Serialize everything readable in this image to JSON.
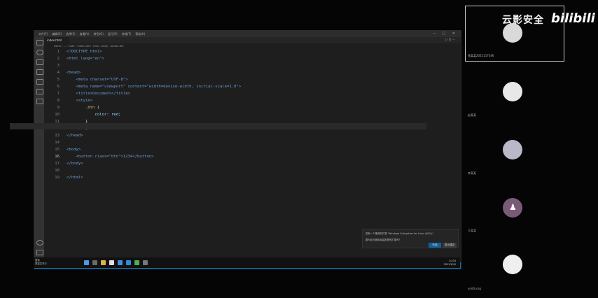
{
  "editor": {
    "menu": [
      "文件(F)",
      "编辑(E)",
      "选择(S)",
      "查看(V)",
      "转到(G)",
      "运行(R)",
      "终端(T)",
      "帮助(H)"
    ],
    "tab_label": "index.html",
    "breadcrumb": "Users › ... › code › index.html › html › body › button.btn",
    "lines": [
      {
        "n": "1",
        "t": "<!DOCTYPE html>"
      },
      {
        "n": "2",
        "t": "<html lang=\"en\">"
      },
      {
        "n": "3",
        "t": ""
      },
      {
        "n": "4",
        "t": "<head>"
      },
      {
        "n": "5",
        "t": "    <meta charset=\"UTF-8\">"
      },
      {
        "n": "6",
        "t": "    <meta name=\"viewport\" content=\"width=device-width, initial-scale=1.0\">"
      },
      {
        "n": "7",
        "t": "    <title>Document</title>"
      },
      {
        "n": "8",
        "t": "    <style>"
      },
      {
        "n": "9",
        "t": "        .btn {"
      },
      {
        "n": "10",
        "t": "            color: red;"
      },
      {
        "n": "11",
        "t": "        }"
      },
      {
        "n": "12",
        "t": "    </style>"
      },
      {
        "n": "13",
        "t": "</head>"
      },
      {
        "n": "14",
        "t": ""
      },
      {
        "n": "15",
        "t": "<body>"
      },
      {
        "n": "16",
        "t": "    <button class=\"btn\">1234</button>"
      },
      {
        "n": "17",
        "t": "</body>"
      },
      {
        "n": "18",
        "t": ""
      },
      {
        "n": "19",
        "t": "</html>"
      }
    ],
    "notification": {
      "line1": "您有一个推荐的扩展 \"Windows Subsystem for Linux (WSL)\"。",
      "line2": "要为此存储库安装推荐的扩展吗？",
      "btn_install": "安装",
      "btn_show": "显示建议"
    },
    "status_text": "⊗ 0 ⚠ 0",
    "status_right": "行 16，列 25   空格: 4   UTF-8   CRLF   HTML"
  },
  "taskbar": {
    "left_text_1": "搜索",
    "left_text_2": "屏幕共享中",
    "clock_time": "20:03",
    "clock_date": "2021/10/5"
  },
  "meeting": {
    "brand_cn": "云影安全",
    "brand_logo": "bilibili",
    "self_name": "张某某2021117346",
    "participants": [
      "赵某某",
      "李某某",
      "王某某",
      "ymlib.org"
    ],
    "avatar_colors": [
      "#d9d9d9",
      "#e8e8e8",
      "#b8b8c8",
      "#7a5a78",
      "#efefef"
    ]
  }
}
